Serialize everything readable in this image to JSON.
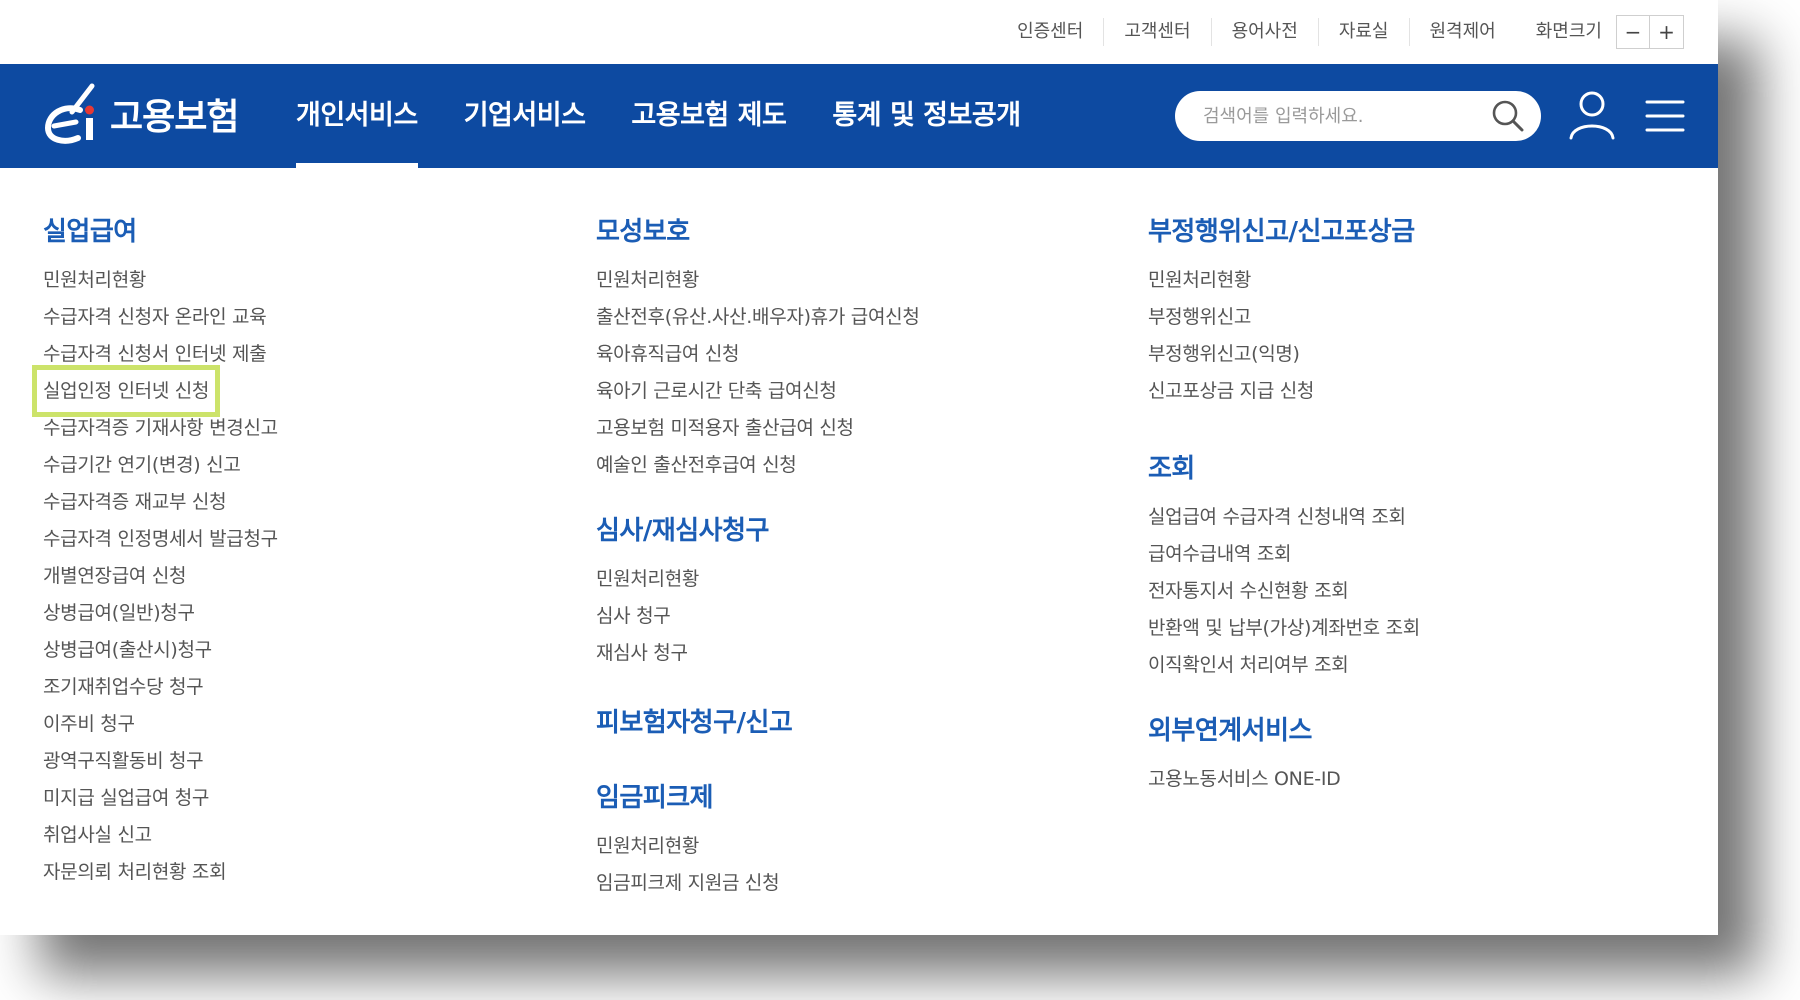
{
  "util_bar": {
    "links": [
      "인증센터",
      "고객센터",
      "용어사전",
      "자료실",
      "원격제어",
      "화면크기"
    ],
    "zoom_out": "−",
    "zoom_in": "+"
  },
  "header": {
    "logo_text": "고용보험",
    "nav": [
      "개인서비스",
      "기업서비스",
      "고용보험 제도",
      "통계 및 정보공개"
    ],
    "active_nav": "개인서비스",
    "search_placeholder": "검색어를 입력하세요.",
    "search_icon": "search-icon",
    "user_icon": "user-icon",
    "menu_icon": "hamburger-menu-icon"
  },
  "mega_menu": {
    "col1": {
      "title": "실업급여",
      "items": [
        "민원처리현황",
        "수급자격 신청자 온라인 교육",
        "수급자격 신청서 인터넷 제출",
        "실업인정 인터넷 신청",
        "수급자격증 기재사항 변경신고",
        "수급기간 연기(변경) 신고",
        "수급자격증 재교부 신청",
        "수급자격 인정명세서 발급청구",
        "개별연장급여 신청",
        "상병급여(일반)청구",
        "상병급여(출산시)청구",
        "조기재취업수당 청구",
        "이주비 청구",
        "광역구직활동비 청구",
        "미지급 실업급여 청구",
        "취업사실 신고",
        "자문의뢰 처리현황 조회"
      ],
      "highlighted": "실업인정 인터넷 신청"
    },
    "col2": {
      "groups": [
        {
          "title": "모성보호",
          "items": [
            "민원처리현황",
            "출산전후(유산.사산.배우자)휴가 급여신청",
            "육아휴직급여 신청",
            "육아기 근로시간 단축 급여신청",
            "고용보험 미적용자 출산급여 신청",
            "예술인 출산전후급여 신청"
          ]
        },
        {
          "title": "심사/재심사청구",
          "items": [
            "민원처리현황",
            "심사 청구",
            "재심사 청구"
          ]
        },
        {
          "title": "피보험자청구/신고",
          "items": []
        },
        {
          "title": "임금피크제",
          "items": [
            "민원처리현황",
            "임금피크제 지원금 신청"
          ]
        }
      ]
    },
    "col3": {
      "groups": [
        {
          "title": "부정행위신고/신고포상금",
          "items": [
            "민원처리현황",
            "부정행위신고",
            "부정행위신고(익명)",
            "신고포상금 지급 신청"
          ]
        },
        {
          "title": "조회",
          "items": [
            "실업급여 수급자격 신청내역 조회",
            "급여수급내역 조회",
            "전자통지서 수신현황 조회",
            "반환액 및 납부(가상)계좌번호 조회",
            "이직확인서 처리여부 조회"
          ]
        },
        {
          "title": "외부연계서비스",
          "items": [
            "고용노동서비스 ONE-ID"
          ]
        }
      ]
    }
  },
  "colors": {
    "nav_bg": "#0d4aa1",
    "category_title": "#1b5db5",
    "highlight_outline": "#cce36a"
  }
}
